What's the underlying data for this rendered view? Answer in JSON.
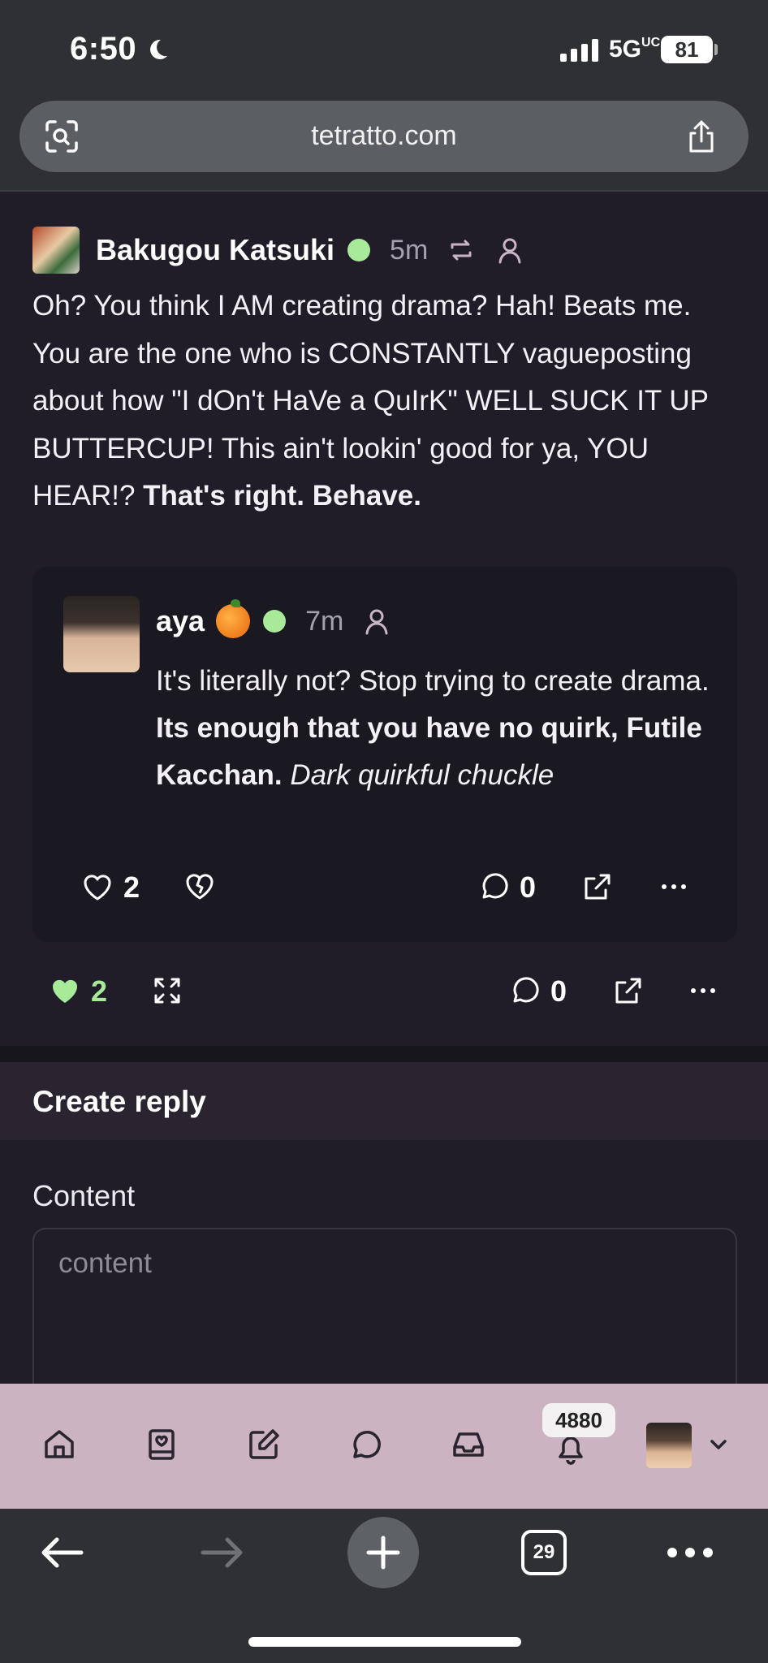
{
  "status": {
    "time": "6:50",
    "network": "5G",
    "network_sup": "UC",
    "battery": "81"
  },
  "browser": {
    "url": "tetratto.com",
    "tabs_count": "29"
  },
  "post": {
    "author": "Bakugou Katsuki",
    "age": "5m",
    "text_plain": "Oh? You think I AM creating drama? Hah! Beats me. You are the one who is CONSTANTLY vagueposting about how \"I dOn't HaVe a QuIrK\" WELL SUCK IT UP BUTTERCUP! This ain't lookin' good for ya, YOU HEAR!? ",
    "text_bold": "That's right. Behave.",
    "likes": "2",
    "comments": "0"
  },
  "quoted": {
    "author": "aya",
    "age": "7m",
    "text_plain": "It's literally not? Stop trying to create drama. ",
    "text_bold": "Its enough that you have no quirk, Futile Kacchan.",
    "text_italic": "Dark quirkful chuckle",
    "likes": "2",
    "comments": "0"
  },
  "reply": {
    "title": "Create reply",
    "content_label": "Content",
    "content_placeholder": "content"
  },
  "nav": {
    "notifications_count": "4880"
  },
  "colors": {
    "online": "#a8ea9a",
    "liked": "#a8ea9a",
    "nav_bg": "#cbb3c2"
  }
}
